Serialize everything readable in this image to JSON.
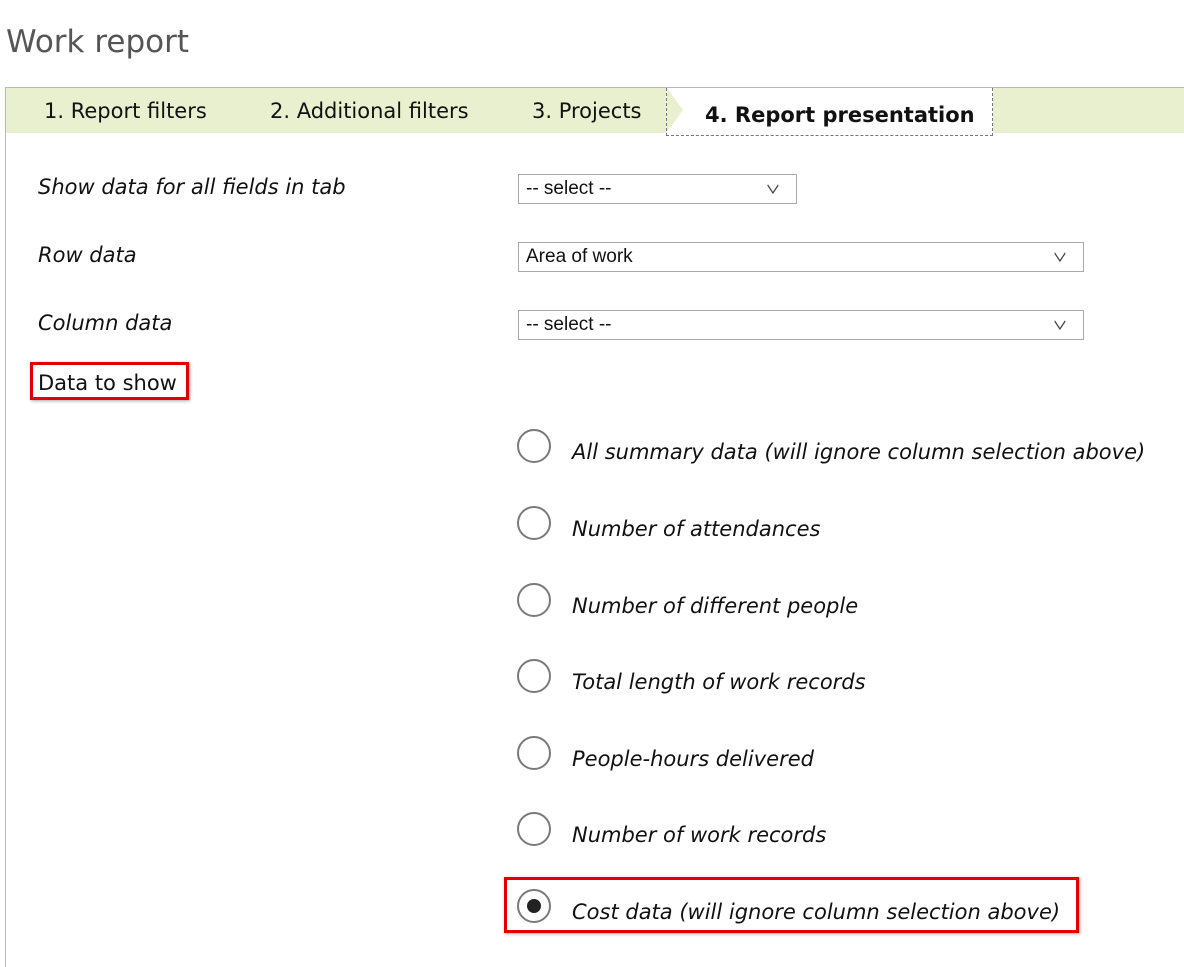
{
  "page": {
    "title": "Work report"
  },
  "tabs": [
    {
      "label": "1. Report filters",
      "active": false
    },
    {
      "label": "2. Additional filters",
      "active": false
    },
    {
      "label": "3. Projects",
      "active": false
    },
    {
      "label": "4. Report presentation",
      "active": true
    }
  ],
  "form": {
    "show_all_fields": {
      "label": "Show data for all fields in tab",
      "value": "-- select --"
    },
    "row_data": {
      "label": "Row data",
      "value": "Area of work"
    },
    "column_data": {
      "label": "Column data",
      "value": "-- select --"
    },
    "data_to_show": {
      "label": "Data to show",
      "options": [
        {
          "label": "All summary data (will ignore column selection above)",
          "checked": false
        },
        {
          "label": "Number of attendances",
          "checked": false
        },
        {
          "label": "Number of different people",
          "checked": false
        },
        {
          "label": "Total length of work records",
          "checked": false
        },
        {
          "label": "People-hours delivered",
          "checked": false
        },
        {
          "label": "Number of work records",
          "checked": false
        },
        {
          "label": "Cost data (will ignore column selection above)",
          "checked": true
        }
      ]
    }
  },
  "colors": {
    "tab_bar": "#e9f0cf",
    "highlight": "#e00000",
    "title": "#555555"
  }
}
